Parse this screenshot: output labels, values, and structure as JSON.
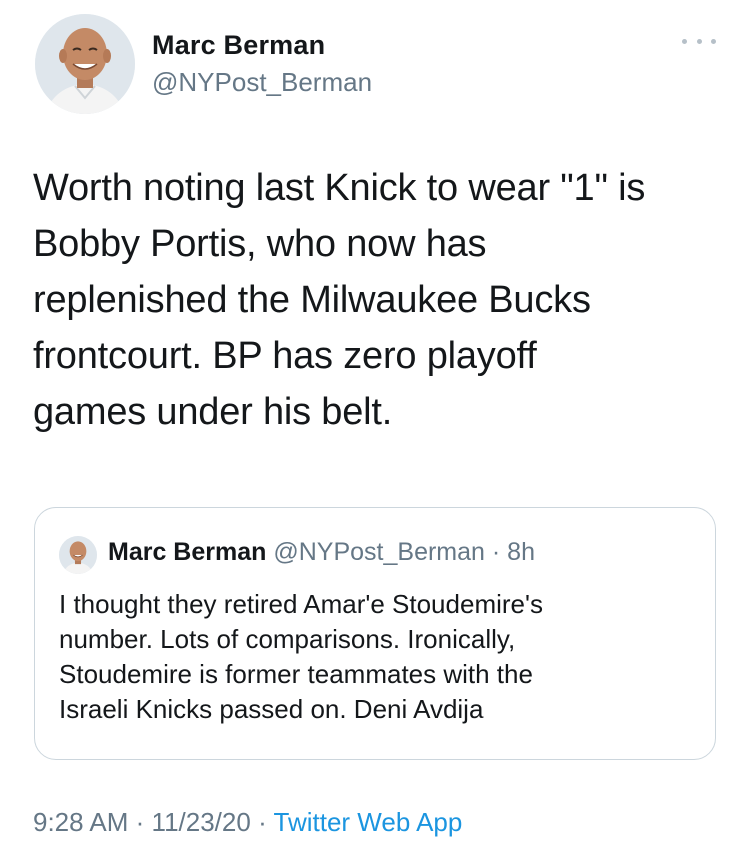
{
  "author": {
    "name": "Marc Berman",
    "handle": "@NYPost_Berman"
  },
  "tweet": {
    "text": "Worth noting last Knick to wear \"1\" is\nBobby Portis, who now has\nreplenished the Milwaukee Bucks\nfrontcourt. BP has zero playoff\ngames under his belt."
  },
  "quote": {
    "name": "Marc Berman",
    "handle": "@NYPost_Berman",
    "separator": "·",
    "time": "8h",
    "text": "I thought they retired Amar'e Stoudemire's\nnumber. Lots of comparisons. Ironically,\nStoudemire is former teammates with the\nIsraeli Knicks passed on. Deni Avdija"
  },
  "meta": {
    "time": "9:28 AM",
    "sep1": "·",
    "date": "11/23/20",
    "sep2": "·",
    "source": "Twitter Web App"
  },
  "icons": {
    "more": "more-horizontal-icon"
  },
  "colors": {
    "text": "#14171a",
    "secondary": "#657786",
    "link": "#1b95e0",
    "border": "#ccd6dd"
  }
}
